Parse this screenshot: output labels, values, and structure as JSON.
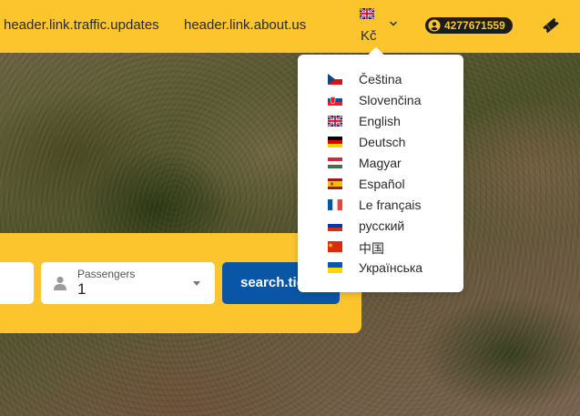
{
  "header": {
    "links": {
      "traffic": "header.link.traffic.updates",
      "about": "header.link.about.us"
    },
    "language_switch": {
      "current_flag": "gb",
      "currency": "Kč",
      "icon": "chevron-down-icon"
    },
    "points": "4277671559",
    "ticket_icon": "ticket-icon"
  },
  "search": {
    "passengers_label": "Passengers",
    "passengers_value": "1",
    "search_button_label": "search.tickets"
  },
  "language_menu": {
    "items": [
      {
        "flag": "cz",
        "label": "Čeština"
      },
      {
        "flag": "sk",
        "label": "Slovenčina"
      },
      {
        "flag": "gb",
        "label": "English"
      },
      {
        "flag": "de",
        "label": "Deutsch"
      },
      {
        "flag": "hu",
        "label": "Magyar"
      },
      {
        "flag": "es",
        "label": "Español"
      },
      {
        "flag": "fr",
        "label": "Le français"
      },
      {
        "flag": "ru",
        "label": "русский"
      },
      {
        "flag": "cn",
        "label": "中国"
      },
      {
        "flag": "ua",
        "label": "Українська"
      }
    ]
  },
  "colors": {
    "brand_yellow": "#fcc52e",
    "primary_blue": "#0a56a6",
    "badge_dark": "#1c1c1c"
  }
}
